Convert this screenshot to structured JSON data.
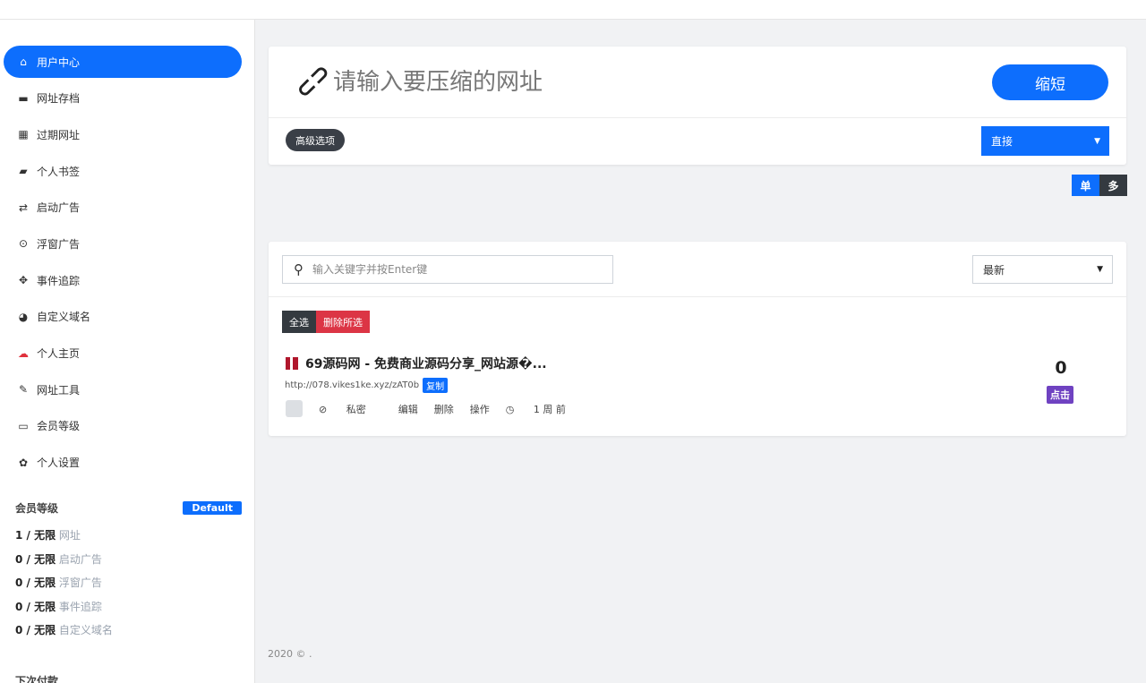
{
  "sidebar": {
    "items": [
      {
        "icon": "home-icon",
        "glyph": "⌂",
        "label": "用户中心",
        "active": true
      },
      {
        "icon": "briefcase-icon",
        "glyph": "▬",
        "label": "网址存档"
      },
      {
        "icon": "calendar-icon",
        "glyph": "▦",
        "label": "过期网址"
      },
      {
        "icon": "folder-open-icon",
        "glyph": "▰",
        "label": "个人书签"
      },
      {
        "icon": "exchange-icon",
        "glyph": "⇄",
        "label": "启动广告"
      },
      {
        "icon": "dot-circle-icon",
        "glyph": "⊙",
        "label": "浮窗广告"
      },
      {
        "icon": "crosshairs-icon",
        "glyph": "✥",
        "label": "事件追踪"
      },
      {
        "icon": "globe-icon",
        "glyph": "◕",
        "label": "自定义域名"
      },
      {
        "icon": "cloud-icon",
        "glyph": "☁",
        "label": "个人主页"
      },
      {
        "icon": "wrench-icon",
        "glyph": "✎",
        "label": "网址工具"
      },
      {
        "icon": "credit-card-icon",
        "glyph": "▭",
        "label": "会员等级"
      },
      {
        "icon": "gear-icon",
        "glyph": "✿",
        "label": "个人设置"
      }
    ],
    "membership": {
      "title": "会员等级",
      "badge": "Default",
      "rows": [
        {
          "value": "1 / 无限",
          "label": "网址"
        },
        {
          "value": "0 / 无限",
          "label": "启动广告"
        },
        {
          "value": "0 / 无限",
          "label": "浮窗广告"
        },
        {
          "value": "0 / 无限",
          "label": "事件追踪"
        },
        {
          "value": "0 / 无限",
          "label": "自定义域名"
        }
      ],
      "next_payment": "下次付款"
    }
  },
  "shortener": {
    "placeholder": "请输入要压缩的网址",
    "submit": "缩短",
    "advanced": "高级选项",
    "redirect_type": "直接",
    "mode_single": "单",
    "mode_multi": "多"
  },
  "links": {
    "search_placeholder": "输入关键字并按Enter键",
    "sort": "最新",
    "select_all": "全选",
    "delete_selected": "删除所选",
    "items": [
      {
        "title": "69源码网 - 免费商业源码分享_网站源�...",
        "url": "http://078.vikes1ke.xyz/zAT0b",
        "copy": "复制",
        "private": "私密",
        "edit": "编辑",
        "delete": "删除",
        "actions": "操作",
        "time": "1 周 前",
        "clicks": "0",
        "clicks_label": "点击"
      }
    ]
  },
  "footer": "2020 © ."
}
